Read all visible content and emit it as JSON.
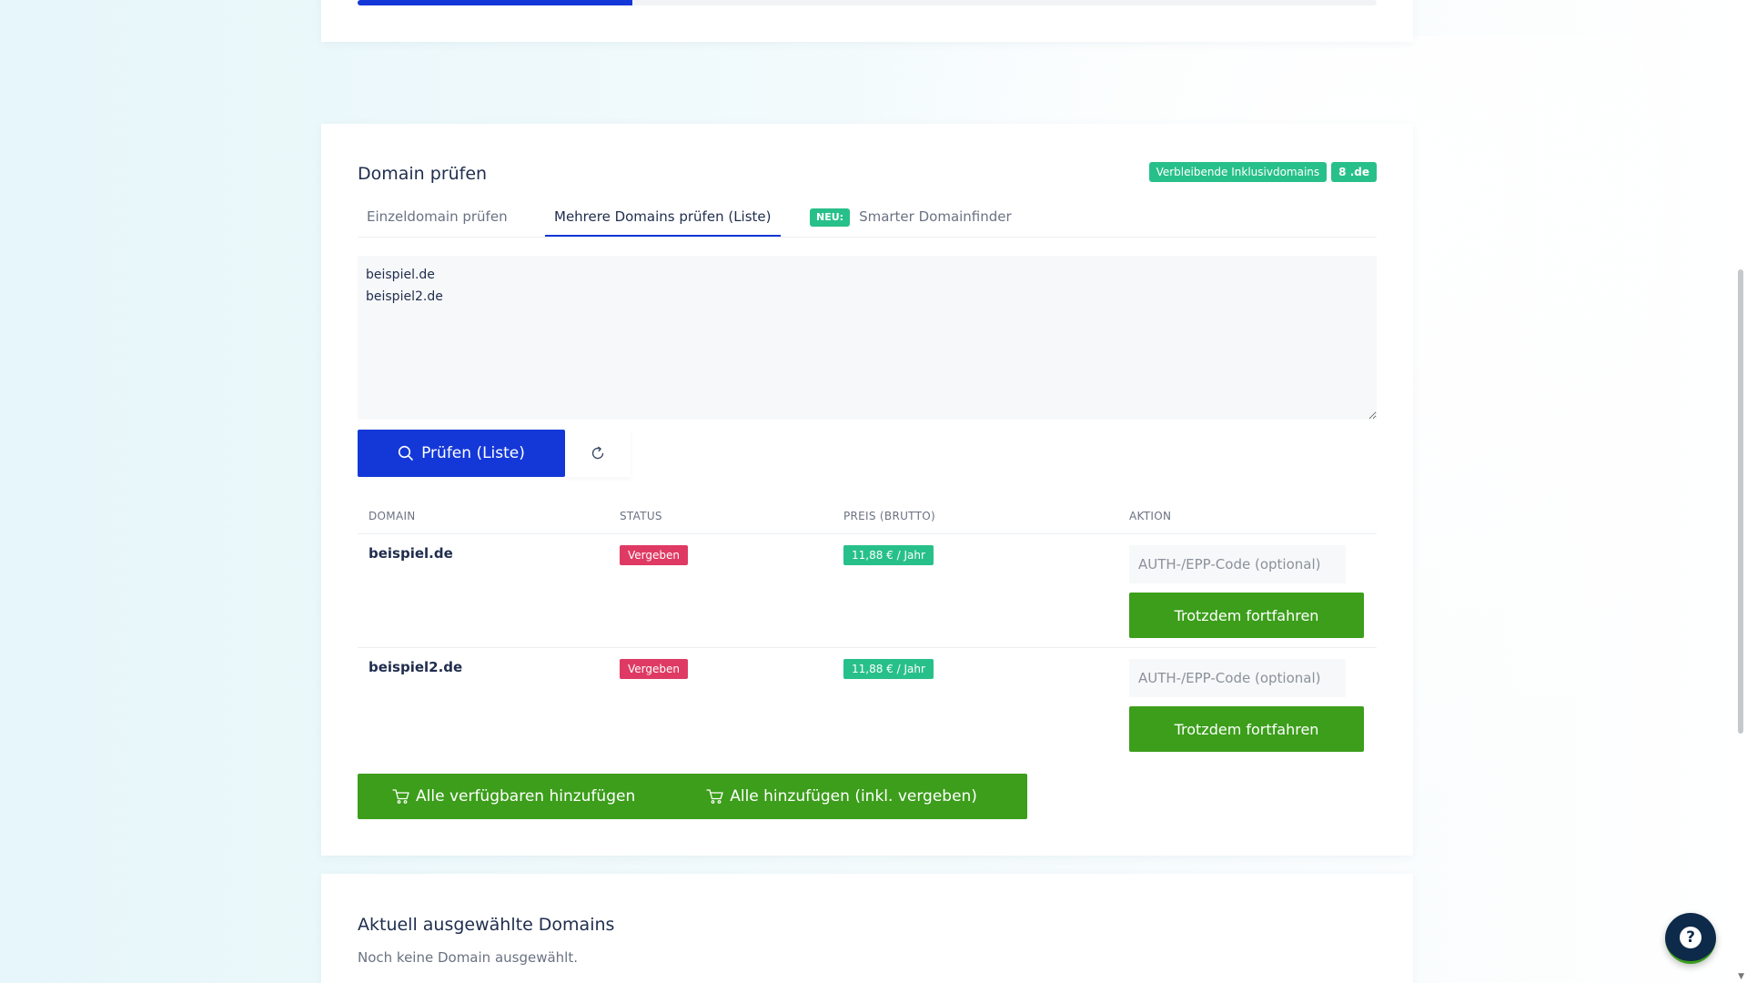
{
  "progress": {
    "fraction": 0.27
  },
  "domain_check": {
    "title": "Domain prüfen",
    "badge_remaining_label": "Verbleibende Inklusivdomains",
    "badge_remaining_value": "8 .de",
    "tabs": [
      {
        "label": "Einzeldomain prüfen",
        "active": false
      },
      {
        "label": "Mehrere Domains prüfen (Liste)",
        "active": true
      },
      {
        "label": "Smarter Domainfinder",
        "new_badge": "NEU:",
        "active": false
      }
    ],
    "textarea_value": "beispiel.de\nbeispiel2.de",
    "check_button": "Prüfen (Liste)",
    "icons": {
      "check": "search-icon",
      "reset": "refresh-icon",
      "cart": "cart-icon",
      "help": "question-icon"
    },
    "table": {
      "headers": [
        "DOMAIN",
        "STATUS",
        "PREIS (BRUTTO)",
        "AKTION"
      ],
      "rows": [
        {
          "domain": "beispiel.de",
          "status": "Vergeben",
          "price": "11,88 € / Jahr",
          "auth_placeholder": "AUTH-/EPP-Code (optional)",
          "action": "Trotzdem fortfahren"
        },
        {
          "domain": "beispiel2.de",
          "status": "Vergeben",
          "price": "11,88 € / Jahr",
          "auth_placeholder": "AUTH-/EPP-Code (optional)",
          "action": "Trotzdem fortfahren"
        }
      ]
    },
    "add_available": "Alle verfügbaren hinzufügen",
    "add_all": "Alle hinzufügen (inkl. vergeben)"
  },
  "selected": {
    "title": "Aktuell ausgewählte Domains",
    "empty": "Noch keine Domain ausgewählt."
  },
  "colors": {
    "primary": "#1438d8",
    "success": "#3c9e1b",
    "badge_green": "#28c08a",
    "status_taken": "#df3a63"
  }
}
